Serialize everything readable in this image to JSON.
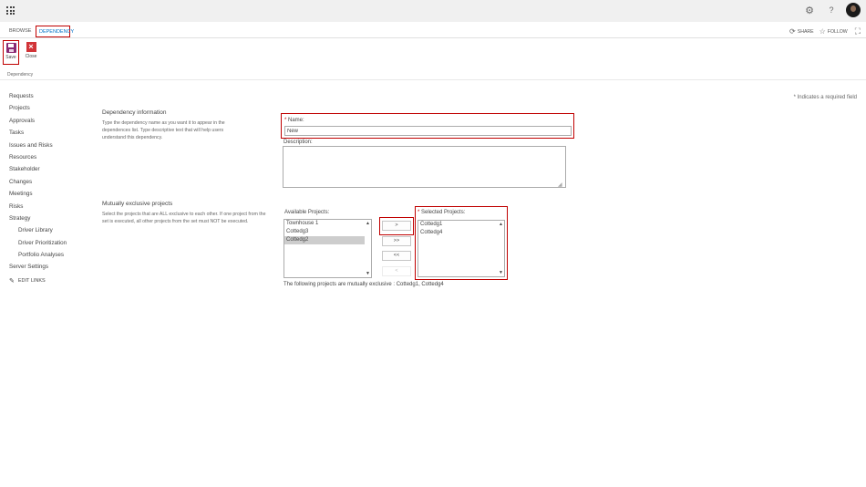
{
  "suite_bar": {
    "app_launcher_icon": "waffle-icon",
    "settings_icon": "gear-icon",
    "help_text": "?",
    "avatar_icon": "user-avatar"
  },
  "ribbon": {
    "tabs": [
      {
        "label": "BROWSE",
        "active": false
      },
      {
        "label": "DEPENDENCY",
        "active": true
      }
    ],
    "actions": {
      "share": "SHARE",
      "follow": "FOLLOW"
    },
    "buttons": {
      "save": "Save",
      "close": "Close"
    },
    "group_label": "Dependency"
  },
  "required_note": "* Indicates a required field",
  "quick_launch": {
    "items": [
      {
        "label": "Requests",
        "level": 0
      },
      {
        "label": "Projects",
        "level": 0
      },
      {
        "label": "Approvals",
        "level": 0
      },
      {
        "label": "Tasks",
        "level": 0
      },
      {
        "label": "Issues and Risks",
        "level": 0
      },
      {
        "label": "Resources",
        "level": 0
      },
      {
        "label": "Stakeholder",
        "level": 0
      },
      {
        "label": "Changes",
        "level": 0
      },
      {
        "label": "Meetings",
        "level": 0
      },
      {
        "label": "Risks",
        "level": 0
      },
      {
        "label": "Strategy",
        "level": 0
      },
      {
        "label": "Driver Library",
        "level": 1
      },
      {
        "label": "Driver Prioritization",
        "level": 1
      },
      {
        "label": "Portfolio Analyses",
        "level": 1
      },
      {
        "label": "Server Settings",
        "level": 0
      }
    ],
    "edit_links": "EDIT LINKS"
  },
  "form": {
    "dependency_info": {
      "title": "Dependency information",
      "description": "Type the dependency name as you want it to appear in the dependences list. Type descriptive text that will help users understand this dependency."
    },
    "name": {
      "star": "*",
      "label": " Name:",
      "value": "New"
    },
    "description": {
      "label": "Description:",
      "value": ""
    },
    "mutually_exclusive": {
      "title": "Mutually exclusive projects",
      "description": "Select the projects that are ALL exclusive to each other. If one project from the set is executed, all other projects from the set must NOT be executed."
    },
    "available": {
      "label": "Available Projects:",
      "items": [
        "Townhouse 1",
        "Cottedg3",
        "Cottedg2"
      ],
      "selected_index": 2
    },
    "move_buttons": {
      "add": ">",
      "add_all": ">>",
      "remove_all": "<<",
      "remove": "<"
    },
    "selected": {
      "star": "*",
      "label": " Selected Projects:",
      "items": [
        "Cottedg1",
        "Cottedg4"
      ]
    },
    "exclusive_message": "The following projects are mutually exclusive : Cottedg1, Cottedg4"
  }
}
